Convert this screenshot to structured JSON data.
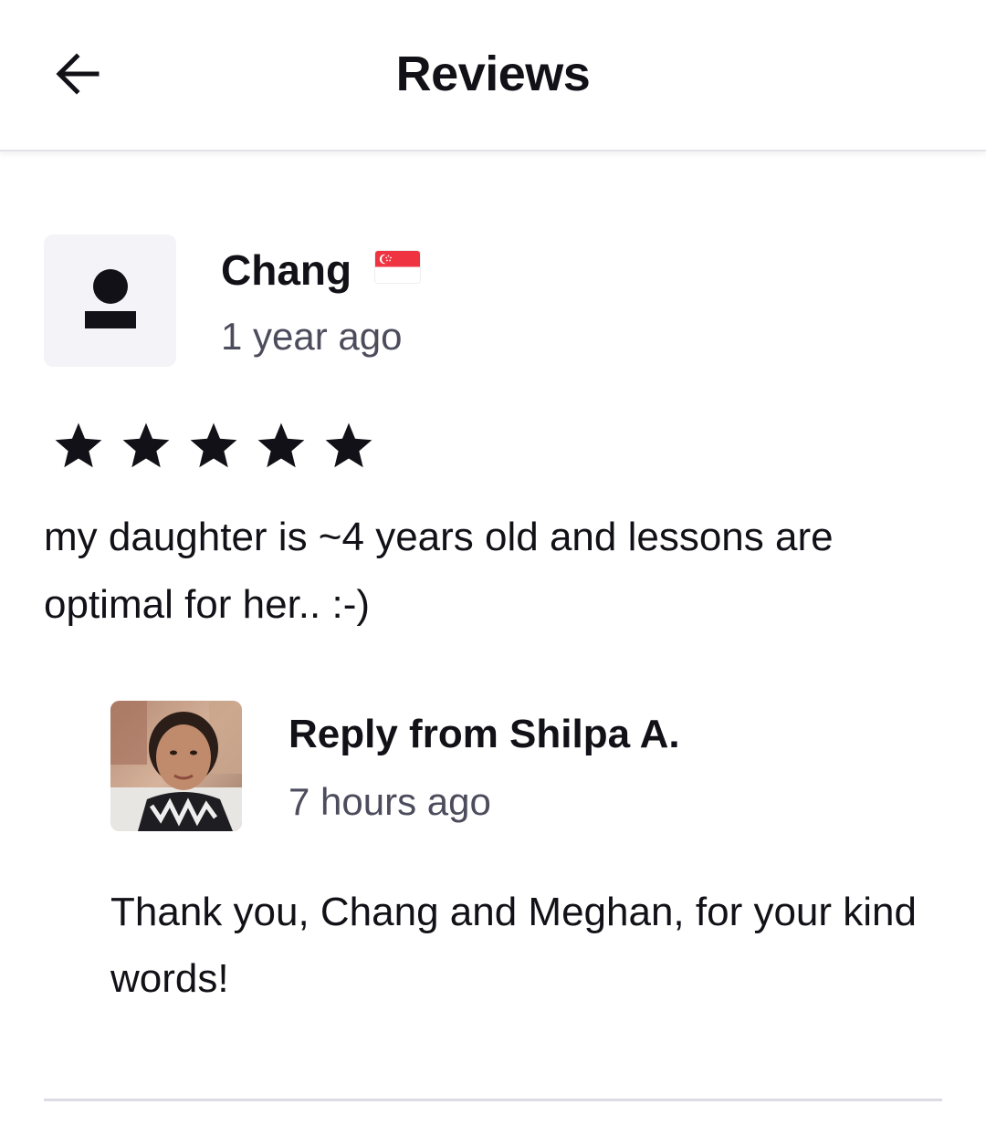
{
  "header": {
    "title": "Reviews",
    "back_icon": "arrow-left-icon"
  },
  "review": {
    "reviewer_name": "Chang",
    "country_flag": "singapore-flag-icon",
    "time": "1 year ago",
    "rating": 5,
    "max_rating": 5,
    "text": "my daughter is ~4 years old and lessons are optimal for her.. :-)"
  },
  "reply": {
    "title": "Reply from Shilpa A.",
    "time": "7 hours ago",
    "text": "Thank you, Chang and Meghan, for your kind words!"
  },
  "colors": {
    "text_primary": "#121117",
    "text_secondary": "#4d4c5c",
    "avatar_bg": "#f4f4f8",
    "star": "#121117",
    "divider": "#dcdce5"
  }
}
